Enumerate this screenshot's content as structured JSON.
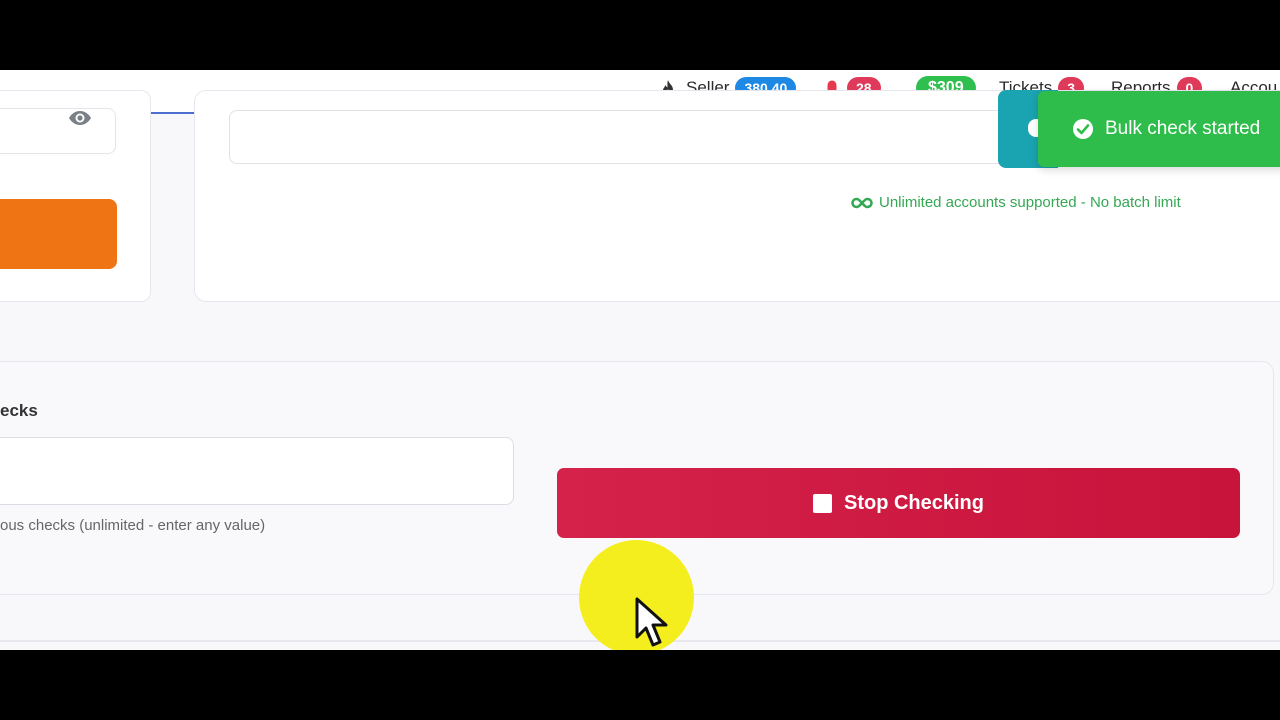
{
  "navbar": {
    "seller_label": "Seller",
    "seller_score": "380.40",
    "notifications_count": "28",
    "balance": "$309",
    "tickets_label": "Tickets",
    "tickets_count": "3",
    "reports_label": "Reports",
    "reports_count": "0",
    "account_label": "Accou"
  },
  "bulk_card": {
    "unlimited_note": "Unlimited accounts supported - No batch limit"
  },
  "concurrency": {
    "label": "ecks",
    "help_text": "ous checks (unlimited - enter any value)"
  },
  "actions": {
    "stop_label": "Stop Checking"
  },
  "toast": {
    "message": "Bulk check started"
  },
  "colors": {
    "stop_button": "#c8133a",
    "toast_success": "#2ebd4a",
    "toast_info": "#1aa3b0",
    "orange_button": "#ee7414",
    "note_green": "#34a853"
  },
  "icons": [
    "flame-icon",
    "bell-icon",
    "eye-icon",
    "infinity-icon",
    "stop-icon",
    "check-circle-icon",
    "cursor-icon"
  ]
}
